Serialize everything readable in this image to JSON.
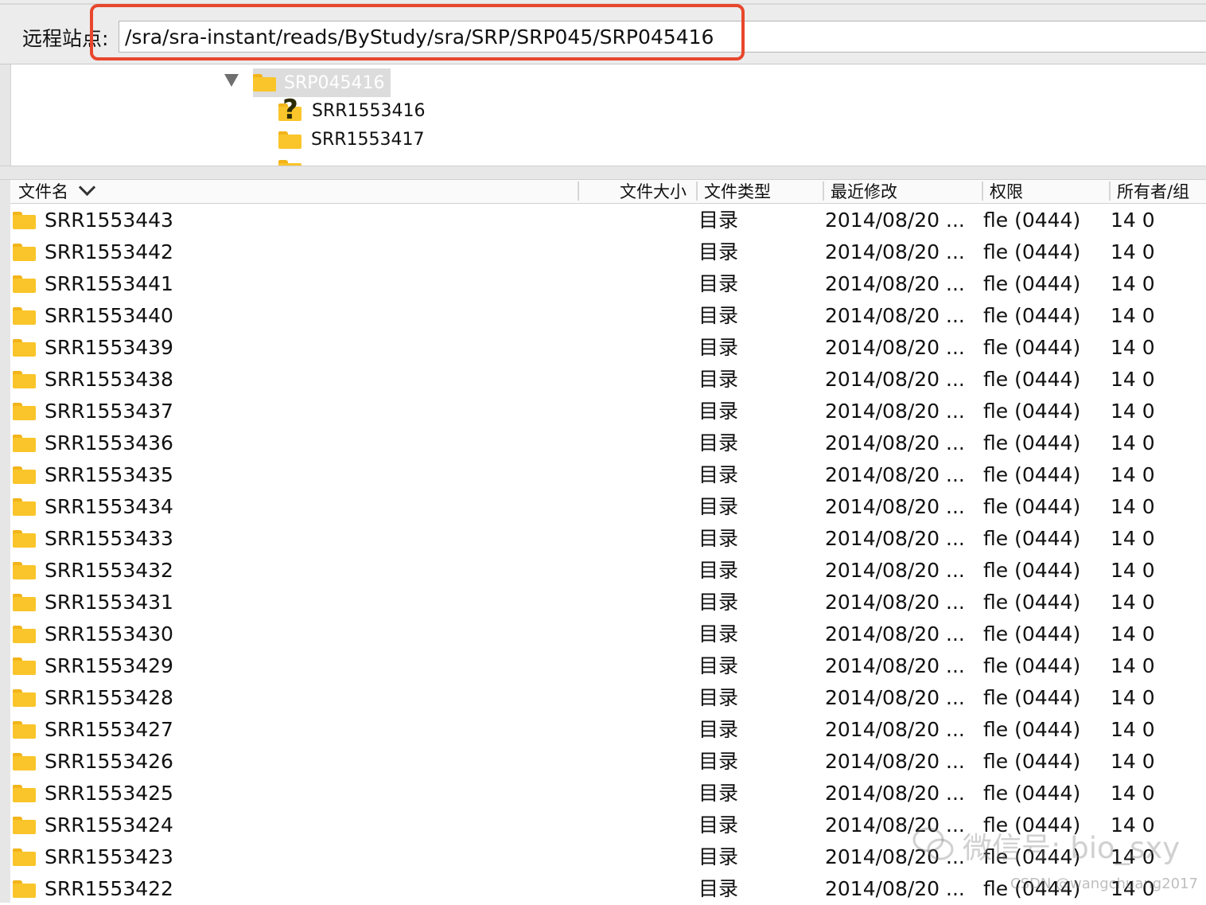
{
  "remote": {
    "label": "远程站点:",
    "path": "/sra/sra-instant/reads/ByStudy/sra/SRP/SRP045/SRP045416",
    "highlight_color": "#e8472d"
  },
  "tree": {
    "selected": "SRP045416",
    "children": [
      {
        "name": "SRR1553416",
        "icon": "question-icon"
      },
      {
        "name": "SRR1553417",
        "icon": "folder-icon"
      }
    ]
  },
  "columns": {
    "name": "文件名",
    "size": "文件大小",
    "type": "文件类型",
    "modified": "最近修改",
    "perm": "权限",
    "owner": "所有者/组"
  },
  "files": [
    {
      "name": "SRR1553443",
      "type": "目录",
      "modified": "2014/08/20 ...",
      "perm": "fle (0444)",
      "owner": "14 0"
    },
    {
      "name": "SRR1553442",
      "type": "目录",
      "modified": "2014/08/20 ...",
      "perm": "fle (0444)",
      "owner": "14 0"
    },
    {
      "name": "SRR1553441",
      "type": "目录",
      "modified": "2014/08/20 ...",
      "perm": "fle (0444)",
      "owner": "14 0"
    },
    {
      "name": "SRR1553440",
      "type": "目录",
      "modified": "2014/08/20 ...",
      "perm": "fle (0444)",
      "owner": "14 0"
    },
    {
      "name": "SRR1553439",
      "type": "目录",
      "modified": "2014/08/20 ...",
      "perm": "fle (0444)",
      "owner": "14 0"
    },
    {
      "name": "SRR1553438",
      "type": "目录",
      "modified": "2014/08/20 ...",
      "perm": "fle (0444)",
      "owner": "14 0"
    },
    {
      "name": "SRR1553437",
      "type": "目录",
      "modified": "2014/08/20 ...",
      "perm": "fle (0444)",
      "owner": "14 0"
    },
    {
      "name": "SRR1553436",
      "type": "目录",
      "modified": "2014/08/20 ...",
      "perm": "fle (0444)",
      "owner": "14 0"
    },
    {
      "name": "SRR1553435",
      "type": "目录",
      "modified": "2014/08/20 ...",
      "perm": "fle (0444)",
      "owner": "14 0"
    },
    {
      "name": "SRR1553434",
      "type": "目录",
      "modified": "2014/08/20 ...",
      "perm": "fle (0444)",
      "owner": "14 0"
    },
    {
      "name": "SRR1553433",
      "type": "目录",
      "modified": "2014/08/20 ...",
      "perm": "fle (0444)",
      "owner": "14 0"
    },
    {
      "name": "SRR1553432",
      "type": "目录",
      "modified": "2014/08/20 ...",
      "perm": "fle (0444)",
      "owner": "14 0"
    },
    {
      "name": "SRR1553431",
      "type": "目录",
      "modified": "2014/08/20 ...",
      "perm": "fle (0444)",
      "owner": "14 0"
    },
    {
      "name": "SRR1553430",
      "type": "目录",
      "modified": "2014/08/20 ...",
      "perm": "fle (0444)",
      "owner": "14 0"
    },
    {
      "name": "SRR1553429",
      "type": "目录",
      "modified": "2014/08/20 ...",
      "perm": "fle (0444)",
      "owner": "14 0"
    },
    {
      "name": "SRR1553428",
      "type": "目录",
      "modified": "2014/08/20 ...",
      "perm": "fle (0444)",
      "owner": "14 0"
    },
    {
      "name": "SRR1553427",
      "type": "目录",
      "modified": "2014/08/20 ...",
      "perm": "fle (0444)",
      "owner": "14 0"
    },
    {
      "name": "SRR1553426",
      "type": "目录",
      "modified": "2014/08/20 ...",
      "perm": "fle (0444)",
      "owner": "14 0"
    },
    {
      "name": "SRR1553425",
      "type": "目录",
      "modified": "2014/08/20 ...",
      "perm": "fle (0444)",
      "owner": "14 0"
    },
    {
      "name": "SRR1553424",
      "type": "目录",
      "modified": "2014/08/20 ...",
      "perm": "fle (0444)",
      "owner": "14 0"
    },
    {
      "name": "SRR1553423",
      "type": "目录",
      "modified": "2014/08/20 ...",
      "perm": "fle (0444)",
      "owner": "14 0"
    },
    {
      "name": "SRR1553422",
      "type": "目录",
      "modified": "2014/08/20 ...",
      "perm": "fle (0444)",
      "owner": "14 0"
    }
  ],
  "watermark": {
    "main": "微信号: bio_sxy",
    "sub": "CSDN @wangchuang2017"
  }
}
